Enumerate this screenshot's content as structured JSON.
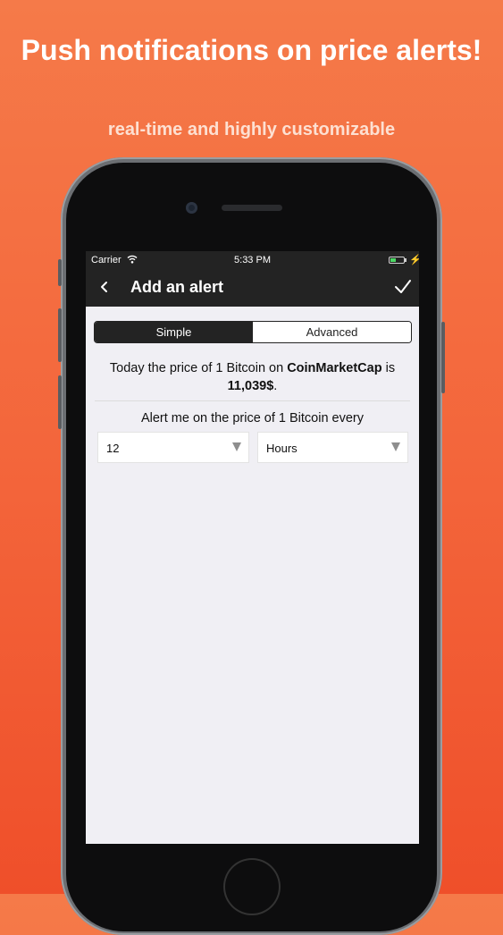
{
  "promo": {
    "headline": "Push notifications on price alerts!",
    "subheadline": "real-time and highly customizable"
  },
  "status_bar": {
    "carrier": "Carrier",
    "time": "5:33 PM"
  },
  "nav": {
    "title": "Add an alert"
  },
  "tabs": {
    "simple": "Simple",
    "advanced": "Advanced",
    "selected": "Simple"
  },
  "price_info": {
    "prefix": "Today the price of 1 Bitcoin on",
    "source": "CoinMarketCap",
    "suffix": "is",
    "price": "11,039$",
    "end": "."
  },
  "alert": {
    "label": "Alert me on the price of 1 Bitcoin every",
    "interval_value": "12",
    "interval_unit": "Hours"
  },
  "colors": {
    "background": "#f3643a",
    "bar": "#232323"
  },
  "icons": [
    "wifi-icon",
    "battery-icon",
    "bolt-icon",
    "back-icon",
    "check-icon",
    "caret-down-icon"
  ]
}
